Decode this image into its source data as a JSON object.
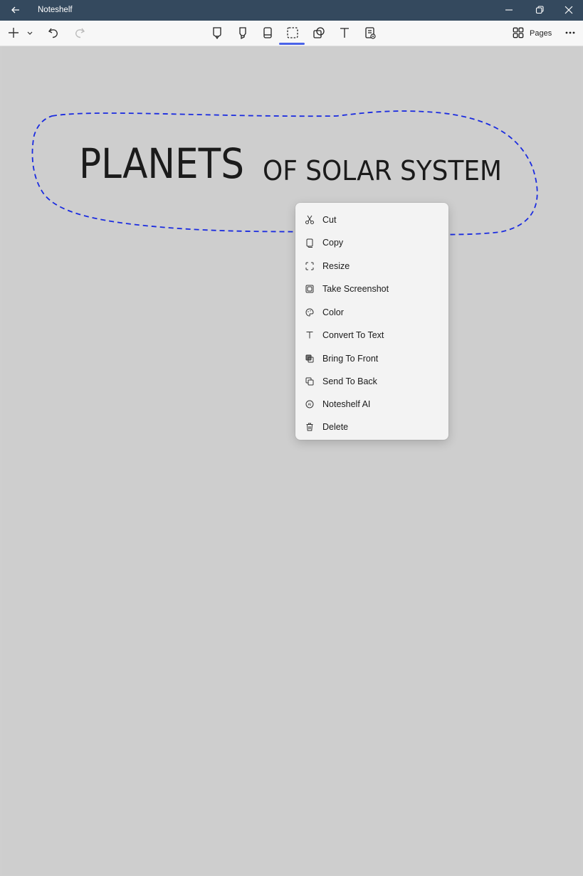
{
  "window": {
    "title": "Noteshelf",
    "back_icon": "arrow-left-icon",
    "minimize_icon": "minimize-icon",
    "restore_icon": "restore-icon",
    "close_icon": "close-icon",
    "title_bar_color": "#34495e"
  },
  "toolbar": {
    "add_icon": "plus-icon",
    "add_dropdown_icon": "chevron-down-icon",
    "undo_icon": "undo-icon",
    "redo_icon": "redo-icon",
    "tools": [
      "pen-icon",
      "highlighter-icon",
      "eraser-icon",
      "lasso-icon",
      "shapes-icon",
      "text-icon",
      "present-icon"
    ],
    "active_tool": "lasso-icon",
    "active_color": "#4a63e8",
    "pages_icon": "grid-icon",
    "pages_label": "Pages",
    "more_icon": "more-icon"
  },
  "canvas": {
    "handwriting_big": "PLANETS",
    "handwriting_small": "OF SOLAR SYSTEM",
    "lasso_color": "#1a2be0"
  },
  "context_menu": {
    "items": [
      {
        "icon": "scissors-icon",
        "label": "Cut"
      },
      {
        "icon": "copy-icon",
        "label": "Copy"
      },
      {
        "icon": "resize-icon",
        "label": "Resize"
      },
      {
        "icon": "screenshot-icon",
        "label": "Take Screenshot"
      },
      {
        "icon": "palette-icon",
        "label": "Color"
      },
      {
        "icon": "text-icon",
        "label": "Convert To Text"
      },
      {
        "icon": "bring-to-front-icon",
        "label": "Bring To Front"
      },
      {
        "icon": "send-to-back-icon",
        "label": "Send To Back"
      },
      {
        "icon": "ai-icon",
        "label": "Noteshelf AI"
      },
      {
        "icon": "trash-icon",
        "label": "Delete"
      }
    ]
  }
}
